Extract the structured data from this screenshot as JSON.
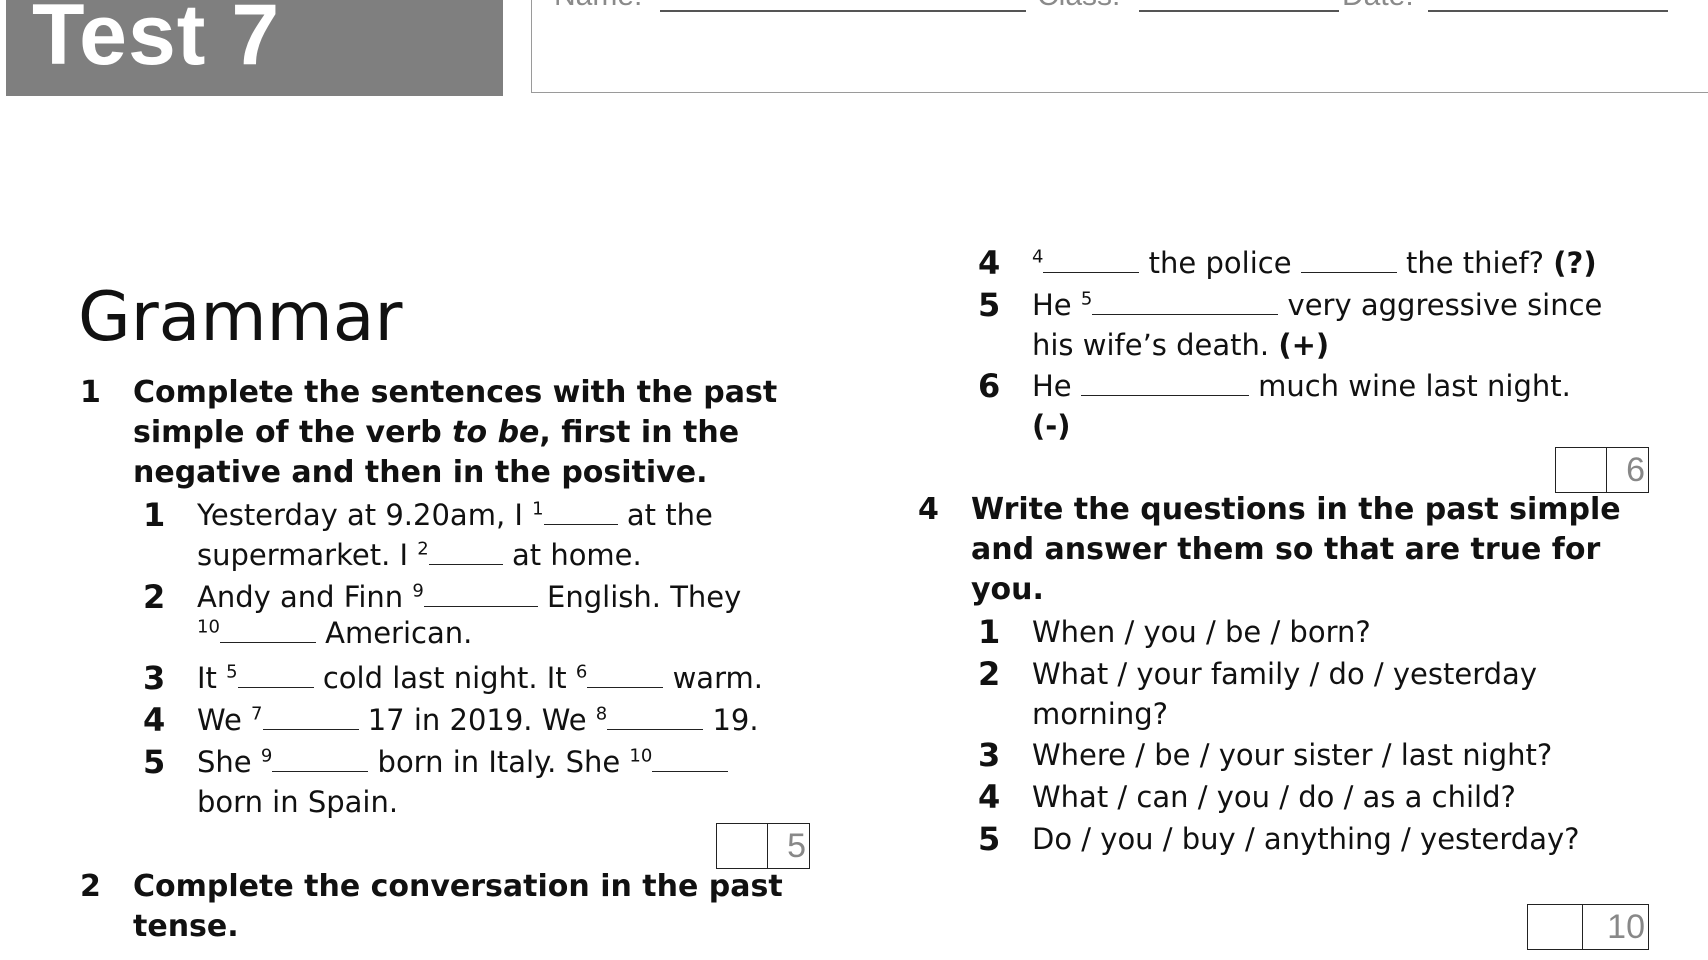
{
  "header": {
    "title": "Test 7",
    "name_label": "Name:",
    "class_label": "Class:",
    "date_label": "Date:"
  },
  "section": {
    "title": "Grammar"
  },
  "task1": {
    "number": "1",
    "line1": "Complete the sentences with the past",
    "line2_a": "simple of the verb ",
    "line2_em": "to be",
    "line2_b": ", first in the",
    "line3": "negative and then in the positive.",
    "items": [
      {
        "n": "1",
        "a": "Yesterday at 9.20am, I ",
        "s1": "1",
        "b": " at the",
        "c": "supermarket. I ",
        "s2": "2",
        "d": " at home."
      },
      {
        "n": "2",
        "a": "Andy and Finn ",
        "s1": "9",
        "b": " English. They",
        "s2": "10",
        "d": " American."
      },
      {
        "n": "3",
        "a": "It ",
        "s1": "5",
        "b": " cold last night. It ",
        "s2": "6",
        "d": " warm."
      },
      {
        "n": "4",
        "a": "We ",
        "s1": "7",
        "b": " 17 in 2019. We ",
        "s2": "8",
        "d": " 19."
      },
      {
        "n": "5",
        "a": "She ",
        "s1": "9",
        "b": " born in Italy. She ",
        "s2": "10",
        "c": "born in Spain."
      }
    ],
    "score": "5"
  },
  "task2": {
    "number": "2",
    "line1": "Complete the conversation in the past",
    "line2": "tense."
  },
  "task3_cont": {
    "items": [
      {
        "n": "4",
        "s1": "4",
        "a": " the police ",
        "b": " the thief? ",
        "mark": "(?)"
      },
      {
        "n": "5",
        "a": "He ",
        "s1": "5",
        "b": " very aggressive since",
        "c": "his wife’s death. ",
        "mark": "(+)"
      },
      {
        "n": "6",
        "a": "He ",
        "b": " much wine last night.",
        "mark": "(-)"
      }
    ],
    "score": "6"
  },
  "task4": {
    "number": "4",
    "line1": "Write the questions in the past simple",
    "line2": "and answer them so that are true for",
    "line3": "you.",
    "items": [
      {
        "n": "1",
        "a": "When / you / be / born?"
      },
      {
        "n": "2",
        "a": "What / your family / do / yesterday",
        "c": "morning?"
      },
      {
        "n": "3",
        "a": "Where / be / your sister / last night?"
      },
      {
        "n": "4",
        "a": "What / can / you / do / as a child?"
      },
      {
        "n": "5",
        "a": "Do / you / buy / anything / yesterday?"
      }
    ],
    "score": "10"
  }
}
